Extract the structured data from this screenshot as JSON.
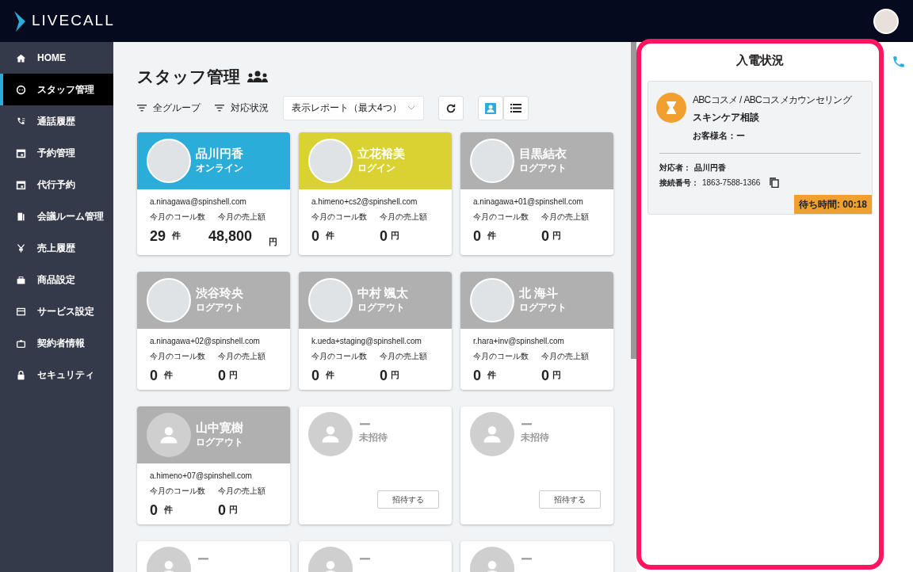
{
  "header": {
    "logo": "LIVECALL"
  },
  "sidebar": {
    "items": [
      {
        "label": "HOME",
        "selected": false
      },
      {
        "label": "スタッフ管理",
        "selected": true
      },
      {
        "label": "通話履歴",
        "selected": false
      },
      {
        "label": "予約管理",
        "selected": false
      },
      {
        "label": "代行予約",
        "selected": false
      },
      {
        "label": "会議ルーム管理",
        "selected": false
      },
      {
        "label": "売上履歴",
        "selected": false
      },
      {
        "label": "商品設定",
        "selected": false
      },
      {
        "label": "サービス設定",
        "selected": false
      },
      {
        "label": "契約者情報",
        "selected": false
      },
      {
        "label": "セキュリティ",
        "selected": false
      }
    ]
  },
  "page": {
    "title": "スタッフ管理",
    "filters": [
      "全グループ",
      "対応状況"
    ],
    "report_select": {
      "placeholder": "表示レポート（最大4つ）"
    },
    "views": [
      {
        "selected": true
      },
      {
        "selected": false
      }
    ],
    "staff": [
      {
        "kind": "staff",
        "photo": true,
        "name": "品川円香",
        "status": "オンライン",
        "color": "#2badd9",
        "email": "a.ninagawa@spinshell.com",
        "calls_label": "今月のコール数",
        "calls": "29",
        "calls_unit": "件",
        "sales_label": "今月の売上額",
        "sales": "48,800",
        "sales_unit": "円"
      },
      {
        "kind": "staff",
        "photo": true,
        "name": "立花裕美",
        "status": "ログイン",
        "color": "#d9d232",
        "email": "a.himeno+cs2@spinshell.com",
        "calls_label": "今月のコール数",
        "calls": "0",
        "calls_unit": "件",
        "sales_label": "今月の売上額",
        "sales": "0",
        "sales_unit": "円"
      },
      {
        "kind": "staff",
        "photo": true,
        "name": "目黒結衣",
        "status": "ログアウト",
        "color": "#b0b0b0",
        "email": "a.ninagawa+01@spinshell.com",
        "calls_label": "今月のコール数",
        "calls": "0",
        "calls_unit": "件",
        "sales_label": "今月の売上額",
        "sales": "0",
        "sales_unit": "円"
      },
      {
        "kind": "staff",
        "photo": true,
        "name": "渋谷玲央",
        "status": "ログアウト",
        "color": "#b0b0b0",
        "email": "a.ninagawa+02@spinshell.com",
        "calls_label": "今月のコール数",
        "calls": "0",
        "calls_unit": "件",
        "sales_label": "今月の売上額",
        "sales": "0",
        "sales_unit": "円"
      },
      {
        "kind": "staff",
        "photo": true,
        "name": "中村 颯太",
        "status": "ログアウト",
        "color": "#b0b0b0",
        "email": "k.ueda+staging@spinshell.com",
        "calls_label": "今月のコール数",
        "calls": "0",
        "calls_unit": "件",
        "sales_label": "今月の売上額",
        "sales": "0",
        "sales_unit": "円"
      },
      {
        "kind": "staff",
        "photo": true,
        "name": "北 海斗",
        "status": "ログアウト",
        "color": "#b0b0b0",
        "email": "r.hara+inv@spinshell.com",
        "calls_label": "今月のコール数",
        "calls": "0",
        "calls_unit": "件",
        "sales_label": "今月の売上額",
        "sales": "0",
        "sales_unit": "円"
      },
      {
        "kind": "staff",
        "photo": false,
        "name": "山中寛樹",
        "status": "ログアウト",
        "color": "#b0b0b0",
        "email": "a.himeno+07@spinshell.com",
        "calls_label": "今月のコール数",
        "calls": "0",
        "calls_unit": "件",
        "sales_label": "今月の売上額",
        "sales": "0",
        "sales_unit": "円"
      },
      {
        "kind": "uninvited",
        "name": "ー",
        "status": "未招待",
        "button": "招待する"
      },
      {
        "kind": "uninvited",
        "name": "ー",
        "status": "未招待",
        "button": "招待する"
      },
      {
        "kind": "uninvited",
        "name": "ー"
      },
      {
        "kind": "uninvited",
        "name": "ー"
      },
      {
        "kind": "uninvited",
        "name": "ー"
      }
    ]
  },
  "incoming": {
    "title": "入電状況",
    "calls": [
      {
        "company": "ABCコスメ / ABCコスメカウンセリング",
        "topic": "スキンケア相談",
        "customer": "お客様名：ー",
        "agent_label": "対応者：",
        "agent": "品川円香",
        "number_label": "接続番号：",
        "number": "1863-7588-1366",
        "wait": "待ち時間: 00:18"
      }
    ]
  }
}
